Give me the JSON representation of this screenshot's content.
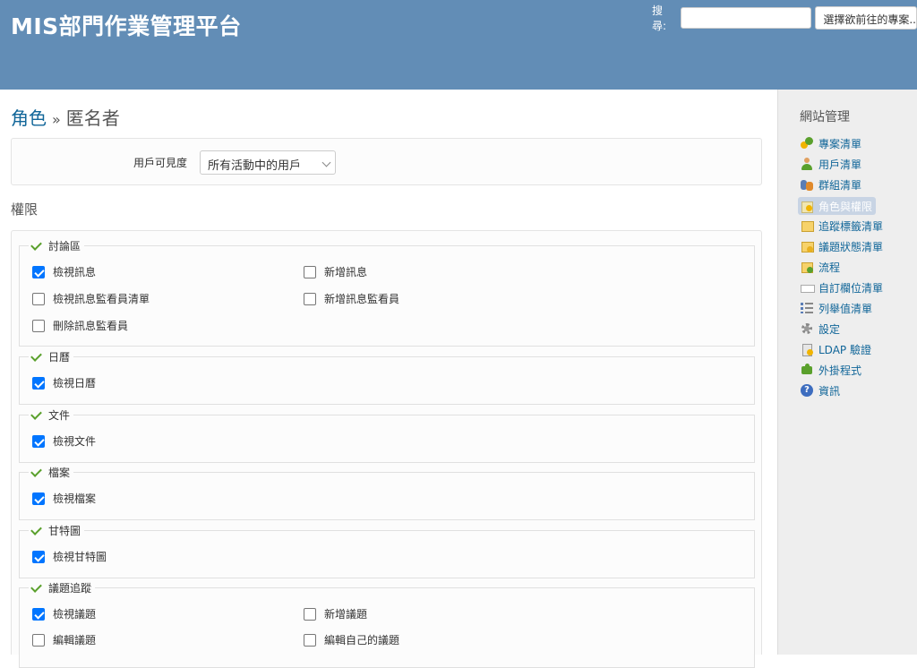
{
  "header": {
    "app_title": "MIS部門作業管理平台",
    "search_label": "搜尋:",
    "search_value": "",
    "project_jump": "選擇欲前往的專案..."
  },
  "breadcrumb": {
    "parent": "角色",
    "separator": "»",
    "current": "匿名者"
  },
  "visibility": {
    "label": "用戶可見度",
    "selected": "所有活動中的用戶"
  },
  "permissions_heading": "權限",
  "groups": [
    {
      "name": "討論區",
      "perms": [
        {
          "label": "檢視訊息",
          "checked": true
        },
        {
          "label": "新增訊息",
          "checked": false
        },
        {
          "label": "檢視訊息監看員清單",
          "checked": false
        },
        {
          "label": "新增訊息監看員",
          "checked": false
        },
        {
          "label": "刪除訊息監看員",
          "checked": false
        }
      ]
    },
    {
      "name": "日曆",
      "perms": [
        {
          "label": "檢視日曆",
          "checked": true
        }
      ]
    },
    {
      "name": "文件",
      "perms": [
        {
          "label": "檢視文件",
          "checked": true
        }
      ]
    },
    {
      "name": "檔案",
      "perms": [
        {
          "label": "檢視檔案",
          "checked": true
        }
      ]
    },
    {
      "name": "甘特圖",
      "perms": [
        {
          "label": "檢視甘特圖",
          "checked": true
        }
      ]
    },
    {
      "name": "議題追蹤",
      "perms": [
        {
          "label": "檢視議題",
          "checked": true
        },
        {
          "label": "新增議題",
          "checked": false
        },
        {
          "label": "編輯議題",
          "checked": false
        },
        {
          "label": "編輯自己的議題",
          "checked": false
        }
      ]
    }
  ],
  "sidebar": {
    "title": "網站管理",
    "items": [
      {
        "label": "專案清單",
        "icon": "projects-icon"
      },
      {
        "label": "用戶清單",
        "icon": "user-icon"
      },
      {
        "label": "群組清單",
        "icon": "group-icon"
      },
      {
        "label": "角色與權限",
        "icon": "roles-icon",
        "selected": true
      },
      {
        "label": "追蹤標籤清單",
        "icon": "tracker-icon"
      },
      {
        "label": "議題狀態清單",
        "icon": "issue-status-icon"
      },
      {
        "label": "流程",
        "icon": "workflow-icon"
      },
      {
        "label": "自訂欄位清單",
        "icon": "custom-field-icon"
      },
      {
        "label": "列舉值清單",
        "icon": "enumeration-icon"
      },
      {
        "label": "設定",
        "icon": "settings-icon"
      },
      {
        "label": "LDAP 驗證",
        "icon": "ldap-icon"
      },
      {
        "label": "外掛程式",
        "icon": "plugin-icon"
      },
      {
        "label": "資訊",
        "icon": "info-icon"
      }
    ]
  }
}
